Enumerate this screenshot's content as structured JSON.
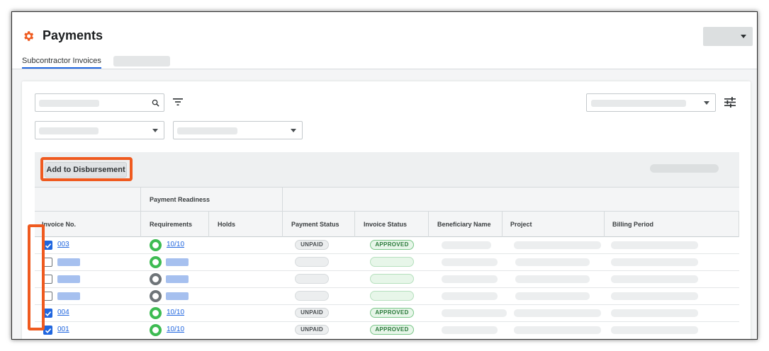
{
  "header": {
    "title": "Payments",
    "icon": "gear-icon",
    "accent_color": "#ef5a1f"
  },
  "tabs": [
    {
      "label": "Subcontractor Invoices",
      "active": true
    }
  ],
  "toolbar": {
    "add_button_label": "Add to Disbursement"
  },
  "table": {
    "group_headers": {
      "payment_readiness": "Payment Readiness"
    },
    "columns": {
      "invoice_no": "Invoice No.",
      "requirements": "Requirements",
      "holds": "Holds",
      "payment_status": "Payment Status",
      "invoice_status": "Invoice Status",
      "beneficiary_name": "Beneficiary Name",
      "project": "Project",
      "billing_period": "Billing Period"
    },
    "rows": [
      {
        "checked": true,
        "invoice": "003",
        "req_ring": "green",
        "requirements": "10/10",
        "payment_status": "UNPAID",
        "invoice_status": "APPROVED"
      },
      {
        "checked": false,
        "invoice": "",
        "req_ring": "green",
        "requirements": "",
        "payment_status": "",
        "invoice_status": ""
      },
      {
        "checked": false,
        "invoice": "",
        "req_ring": "gray",
        "requirements": "",
        "payment_status": "",
        "invoice_status": ""
      },
      {
        "checked": false,
        "invoice": "",
        "req_ring": "gray",
        "requirements": "",
        "payment_status": "",
        "invoice_status": ""
      },
      {
        "checked": true,
        "invoice": "004",
        "req_ring": "green",
        "requirements": "10/10",
        "payment_status": "UNPAID",
        "invoice_status": "APPROVED"
      },
      {
        "checked": true,
        "invoice": "001",
        "req_ring": "green",
        "requirements": "10/10",
        "payment_status": "UNPAID",
        "invoice_status": "APPROVED"
      }
    ]
  },
  "colors": {
    "highlight": "#ef5a1f",
    "link": "#2066df",
    "ready_green": "#3dbb52",
    "not_ready_gray": "#6e7478"
  }
}
